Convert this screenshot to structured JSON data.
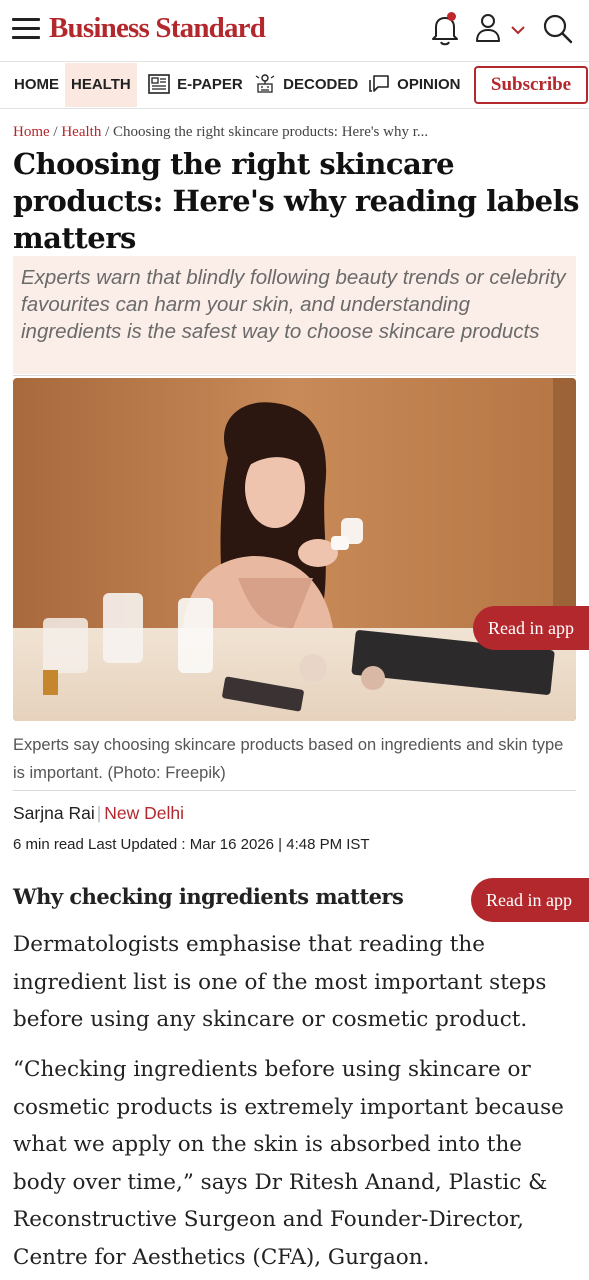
{
  "header": {
    "logo": "Business Standard",
    "icons": [
      "menu-icon",
      "notification-bell-icon",
      "user-icon",
      "chevron-down-icon",
      "search-icon"
    ]
  },
  "nav": {
    "items": [
      {
        "label": "HOME",
        "icon": null
      },
      {
        "label": "HEALTH",
        "icon": null,
        "active": true
      },
      {
        "label": "E-PAPER",
        "icon": "newspaper-icon"
      },
      {
        "label": "DECODED",
        "icon": "decoded-icon"
      },
      {
        "label": "OPINION",
        "icon": "opinion-icon"
      }
    ],
    "subscribe_label": "Subscribe"
  },
  "breadcrumb": {
    "home": "Home",
    "separator": "/",
    "section": "Health",
    "current": "Choosing the right skincare products: Here's why r..."
  },
  "article": {
    "title": "Choosing the right skincare products: Here's why reading labels matters",
    "summary": "Experts warn that blindly following beauty trends or celebrity favourites can harm your skin, and understanding ingredients is the safest way to choose skincare products",
    "image_caption": "Experts say choosing skincare products based on ingredients and skin type is important. (Photo: Freepik)",
    "author": "Sarjna Rai",
    "location": "New Delhi",
    "meta": "6 min read Last Updated : Mar 16 2026 | 4:48 PM IST",
    "subheading": "Why checking ingredients matters",
    "paragraphs": [
      "Dermatologists emphasise that reading the ingredient list is one of the most important steps before using any skincare or cosmetic product.",
      "“Checking ingredients before using skincare or cosmetic products is extremely important because what we apply on the skin is absorbed into the body over time,” says Dr Ritesh Anand, Plastic & Reconstructive Surgeon and Founder-Director, Centre for Aesthetics (CFA), Gurgaon."
    ]
  },
  "read_in_app_label": "Read in app",
  "colors": {
    "brand": "#b3282d",
    "summary_bg": "#fbeee8",
    "active_tab_bg": "#fbe9e1"
  }
}
